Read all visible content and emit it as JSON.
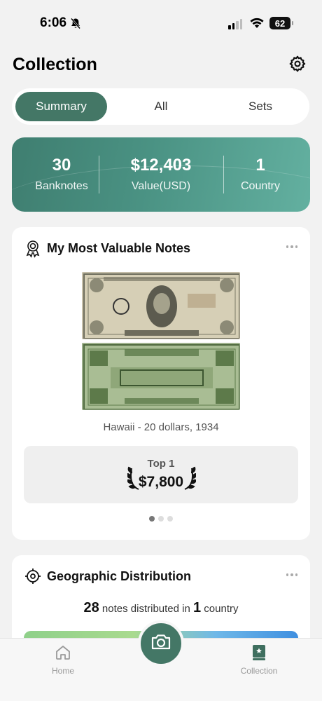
{
  "status_bar": {
    "time": "6:06",
    "battery": "62"
  },
  "header": {
    "title": "Collection"
  },
  "tabs": [
    {
      "label": "Summary",
      "active": true
    },
    {
      "label": "All",
      "active": false
    },
    {
      "label": "Sets",
      "active": false
    }
  ],
  "stats": [
    {
      "value": "30",
      "label": "Banknotes"
    },
    {
      "value": "$12,403",
      "label": "Value(USD)"
    },
    {
      "value": "1",
      "label": "Country"
    }
  ],
  "valuable": {
    "title": "My Most Valuable Notes",
    "caption": "Hawaii - 20 dollars, 1934",
    "rank": "Top 1",
    "value": "$7,800",
    "carousel": {
      "count": 3,
      "active": 1
    }
  },
  "geo": {
    "title": "Geographic Distribution",
    "notes_count": "28",
    "text_mid": "notes distributed in",
    "country_count": "1",
    "text_end": "country"
  },
  "bottom_nav": {
    "home": "Home",
    "collection": "Collection"
  },
  "colors": {
    "accent": "#447766",
    "gradient_start": "#3f7e70",
    "gradient_end": "#63b0a0"
  }
}
